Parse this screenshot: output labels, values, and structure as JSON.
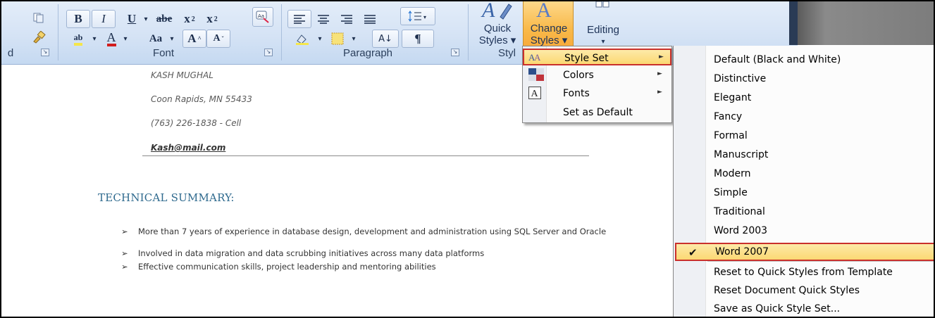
{
  "ribbon": {
    "clipboard_partial_label": "d",
    "groups": {
      "font": "Font",
      "paragraph": "Paragraph",
      "styles_partial": "Styl"
    },
    "font_buttons": {
      "bold": "B",
      "italic": "I",
      "underline": "U",
      "strike": "abe",
      "subscript": "x",
      "superscript": "x",
      "highlight": "ab",
      "font_color": "A",
      "change_case": "Aa",
      "grow": "A",
      "shrink": "A"
    },
    "paragraph_buttons": {
      "sort": "A↓",
      "pilcrow": "¶"
    },
    "quick_styles": {
      "line1": "Quick",
      "line2": "Styles"
    },
    "change_styles": {
      "line1": "Change",
      "line2": "Styles"
    },
    "editing": "Editing"
  },
  "document": {
    "name": "KASH MUGHAL",
    "address": "Coon Rapids, MN 55433",
    "phone": "(763) 226-1838 - Cell",
    "email": "Kash@mail.com",
    "section_heading": "TECHNICAL SUMMARY:",
    "bullets": [
      "More than 7 years of experience in database design, development and administration using SQL Server and Oracle",
      "Involved in data migration and data scrubbing initiatives across many data platforms",
      "Effective communication skills, project leadership and mentoring abilities"
    ],
    "bullet_mark": "➢"
  },
  "change_styles_menu": {
    "items": [
      {
        "label": "Style Set",
        "icon": "style-set-icon",
        "submenu": true,
        "highlighted": true
      },
      {
        "label": "Colors",
        "icon": "colors-icon",
        "submenu": true
      },
      {
        "label": "Fonts",
        "icon": "fonts-icon",
        "submenu": true
      },
      {
        "label": "Set as Default",
        "icon": "",
        "submenu": false
      }
    ]
  },
  "style_set_menu": {
    "items": [
      "Default (Black and White)",
      "Distinctive",
      "Elegant",
      "Fancy",
      "Formal",
      "Manuscript",
      "Modern",
      "Simple",
      "Traditional",
      "Word 2003",
      "Word 2007"
    ],
    "checked": "Word 2007",
    "actions": [
      "Reset to Quick Styles from Template",
      "Reset Document Quick Styles",
      "Save as Quick Style Set..."
    ]
  },
  "colors": {
    "highlight_border": "#c9302c",
    "heading": "#2f6a8e",
    "menu_highlight": "#fbd873"
  }
}
